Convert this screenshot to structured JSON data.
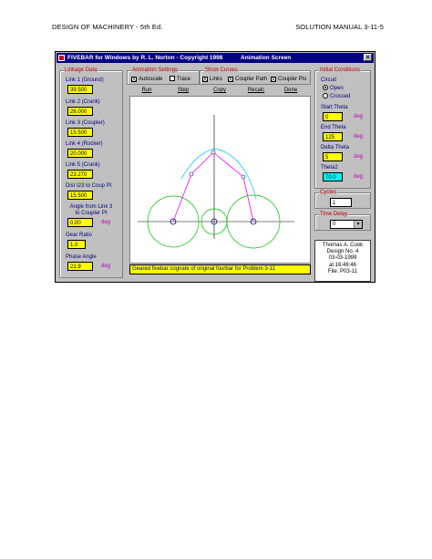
{
  "header": {
    "left": "DESIGN OF MACHINERY - 5th Ed.",
    "right": "SOLUTION MANUAL  3-11-5"
  },
  "window": {
    "title": "FIVEBAR for Windows by R. L. Norton - Copyright 1998",
    "screen": "Animation Screen",
    "close": "×"
  },
  "linkage": {
    "title": "Linkage Data",
    "link1_label": "Link 1 (Ground)",
    "link1": "39.500",
    "link2_label": "Link 2 (Crank)",
    "link2": "26.000",
    "link3_label": "Link 3 (Coupler)",
    "link3": "15.500",
    "link4_label": "Link 4 (Rocker)",
    "link4": "20.000",
    "link5_label": "Link 5 (Crank)",
    "link5": "23.270",
    "dist_label": "Dist I23 to Coup Pt",
    "dist": "15.500",
    "angle_label1": "Angle from Link 3",
    "angle_label2": "to Coupler Pt",
    "angle": "0.00",
    "angle_unit": "deg",
    "gear_label": "Gear Ratio",
    "gear": "1.0",
    "phase_label": "Phase Angle",
    "phase": "21.9",
    "phase_unit": "deg"
  },
  "animation": {
    "title": "Animation Settings",
    "autoscale": "Autoscale",
    "trace": "Trace",
    "autoscale_checked": "X",
    "trace_checked": ""
  },
  "curves": {
    "title": "Show Curves",
    "links": "Links",
    "coupler_path": "Coupler Path",
    "coupler_pts": "Coupler Pts",
    "links_checked": "X",
    "path_checked": "X",
    "pts_checked": "X"
  },
  "toolbar": {
    "run": "Run",
    "step": "Step",
    "copy": "Copy",
    "recalc": "Recalc",
    "done": "Done"
  },
  "initial": {
    "title": "Initial Conditions",
    "circuit_label": "Circuit",
    "open": "Open",
    "crossed": "Crossed",
    "start_label": "Start Theta",
    "start": "0",
    "start_unit": "deg",
    "end_label": "End Theta",
    "end": "125",
    "end_unit": "deg",
    "delta_label": "Delta Theta",
    "delta": "5",
    "delta_unit": "deg",
    "theta2_label": "Theta2",
    "theta2": "70.0",
    "theta2_unit": "deg"
  },
  "cycles": {
    "title": "Cycles",
    "value": "1"
  },
  "timedelay": {
    "title": "Time Delay",
    "value": "0",
    "arrow": "▼"
  },
  "status_text": "Geared fivebar cognate of original fourbar for Problem 3-11",
  "info": {
    "name": "Thomas A. Cook",
    "design": "Design No.  4",
    "date": "03-03-1999",
    "time": "at 16:46:46",
    "file": "File: P03-11"
  },
  "colors": {
    "titlebar": "#000080",
    "field": "#ffff00",
    "theta2_field": "#00ffff",
    "links": "#ff00ff",
    "coupler_path": "#00c0ff",
    "circles": "#00c000",
    "pivots": "#000080"
  }
}
